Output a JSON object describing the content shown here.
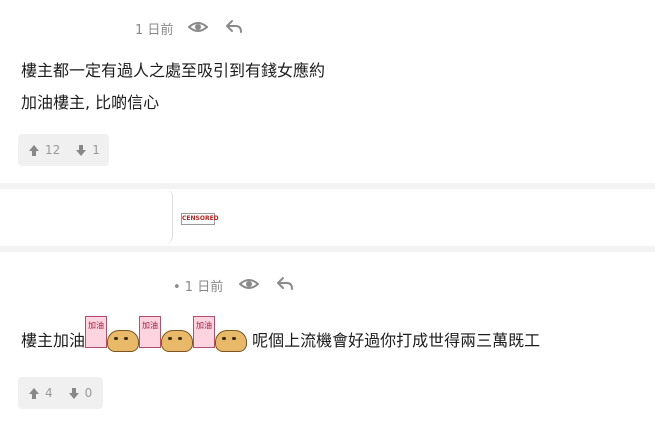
{
  "comment1": {
    "time": "1 日前",
    "lines": [
      "樓主都一定有過人之處至吸引到有錢女應約",
      "加油樓主, 比啲信心"
    ],
    "upvotes": "12",
    "downvotes": "1"
  },
  "collapsed": {
    "censor_label": "CENSORED"
  },
  "comment2": {
    "time": "• 1 日前",
    "text_before": "樓主加油",
    "sticker_label": "加油",
    "text_after": "呢個上流機會好過你打成世得兩三萬既工",
    "upvotes": "4",
    "downvotes": "0"
  },
  "icons": [
    "eye-icon",
    "reply-icon",
    "thumb-up-arrow-icon",
    "thumb-down-arrow-icon",
    "sticker-icon"
  ],
  "colors": {
    "meta_text": "#8a8a8a",
    "separator": "#f3f3f3",
    "vote_bar": "#f0f0f0"
  }
}
